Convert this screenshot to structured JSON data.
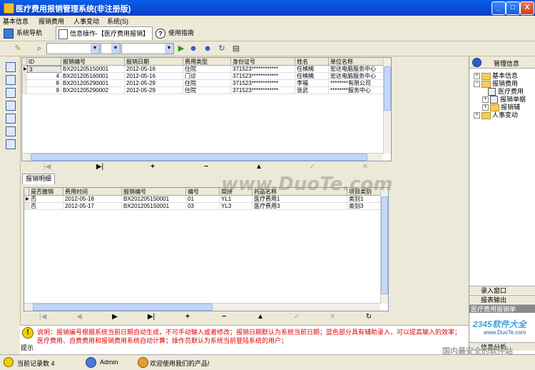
{
  "window": {
    "title": "医疗费用报销管理系统(非注册版)",
    "min_label": "_",
    "max_label": "□",
    "close_label": "X"
  },
  "menu": [
    "基本信息",
    "报销费用",
    "人事变动",
    "系统(S)"
  ],
  "nav": {
    "tab1": "系统导航",
    "tab2": "信息操作-【医疗费用报销】",
    "tab3": "使用指南"
  },
  "toolbar": {
    "combo1": "",
    "combo2": "",
    "combo3": ""
  },
  "main_grid": {
    "columns": [
      "ID",
      "报销编号",
      "报销日期",
      "费用类型",
      "身份证号",
      "姓名",
      "单位名称"
    ],
    "rows": [
      {
        "id": "3",
        "code": "BX201205150001",
        "date": "2012-05-16",
        "type": "住院",
        "idno": "371523************",
        "name": "任楠楠",
        "unit": "宏达电脑服务中心"
      },
      {
        "id": "4",
        "code": "BX201205160001",
        "date": "2012-05-16",
        "type": "门诊",
        "idno": "371523************",
        "name": "任楠楠",
        "unit": "宏达电脑服务中心"
      },
      {
        "id": "8",
        "code": "BX201205290001",
        "date": "2012-05-29",
        "type": "住院",
        "idno": "371523************",
        "name": "李福",
        "unit": "********有限公司"
      },
      {
        "id": "9",
        "code": "BX201205290002",
        "date": "2012-05-29",
        "type": "住院",
        "idno": "371523************",
        "name": "张武",
        "unit": "********服务中心"
      }
    ]
  },
  "nav1": [
    "|◀",
    "▶|",
    "+",
    "−",
    "▲",
    "✓",
    "✕"
  ],
  "detail_tab": "报销明细",
  "detail_grid": {
    "columns": [
      "是否撤销",
      "费用时间",
      "报销编号",
      "编号",
      "简拼",
      "药品名称",
      "项目类别"
    ],
    "rows": [
      {
        "revoked": "否",
        "time": "2012-05-18",
        "code": "BX201205150001",
        "no": "01",
        "abbr": "YL1",
        "drug": "医疗费用1",
        "cat": "类别1"
      },
      {
        "revoked": "否",
        "time": "2012-05-17",
        "code": "BX201205150001",
        "no": "03",
        "abbr": "YL3",
        "drug": "医疗费用3",
        "cat": "类别3"
      }
    ]
  },
  "nav2": [
    "|◀",
    "◀",
    "▶",
    "▶|",
    "+",
    "−",
    "▲",
    "✓",
    "✕",
    "↻"
  ],
  "watermark": "www.DuoTe.com",
  "right_panel": {
    "header": "管理信息",
    "tree": [
      {
        "label": "基本信息",
        "level": 0,
        "expander": "+"
      },
      {
        "label": "报销费用",
        "level": 0,
        "expander": "−"
      },
      {
        "label": "医疗费用",
        "level": 1,
        "expander": ""
      },
      {
        "label": "报销单据",
        "level": 1,
        "expander": "+"
      },
      {
        "label": "报销辅",
        "level": 1,
        "expander": "+"
      },
      {
        "label": "人事变动",
        "level": 0,
        "expander": "+"
      }
    ],
    "buttons": [
      "录入窗口",
      "报表输出",
      "医疗费用报销单",
      "信息分析"
    ]
  },
  "note": {
    "label": "提示",
    "text": "说明：报销编号根据系统当前日期自动生成，不可手动输入或者修改；报销日期默认为系统当前日期；蓝色部分具有辅助录入，可以提高输入的效率；医疗费用、自费费用和报销费用系统自动计算；操作员默认为系统当前登陆系统的用户；"
  },
  "status": {
    "records": "当前记录数 4",
    "user": "Admin",
    "welcome": "欢迎使用我们的产品!",
    "logo": "2345软件大全",
    "logo_url": "www.DuoTe.com",
    "logo_sub": "国内最安全的软件站"
  },
  "colors": {
    "title_bar": "#0b3fc4",
    "note_text": "#e00000",
    "selected_row": "#e8e8e8"
  }
}
